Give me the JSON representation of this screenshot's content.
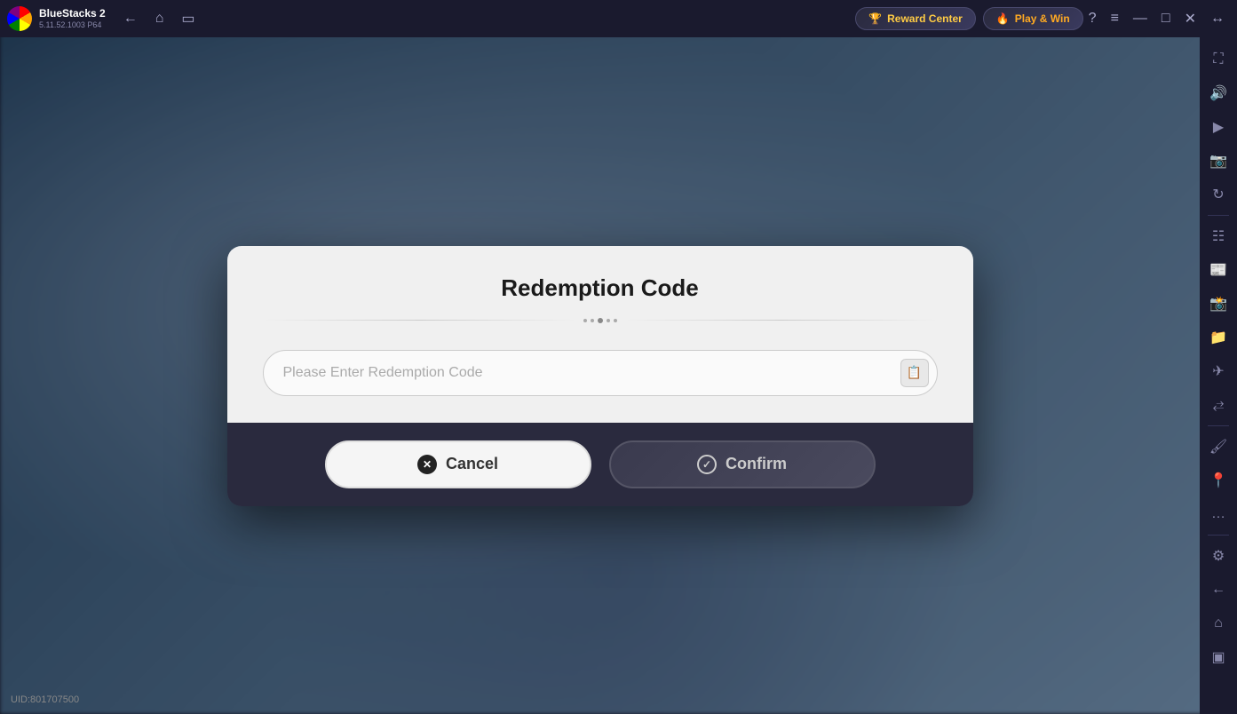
{
  "app": {
    "name": "BlueStacks 2",
    "version": "5.11.52.1003  P64"
  },
  "topbar": {
    "nav_back_label": "←",
    "nav_home_label": "⌂",
    "nav_tabs_label": "⧉",
    "reward_center_label": "Reward Center",
    "play_win_label": "Play & Win",
    "help_icon": "?",
    "menu_icon": "≡",
    "minimize_icon": "—",
    "maximize_icon": "□",
    "close_icon": "✕",
    "expand_icon": "↔"
  },
  "sidebar": {
    "icons": [
      {
        "name": "fullscreen-icon",
        "glyph": "⛶"
      },
      {
        "name": "volume-icon",
        "glyph": "🔊"
      },
      {
        "name": "video-icon",
        "glyph": "▶"
      },
      {
        "name": "camera-icon",
        "glyph": "📷"
      },
      {
        "name": "rotate-icon",
        "glyph": "↻"
      },
      {
        "name": "layers-icon",
        "glyph": "⊞"
      },
      {
        "name": "news-icon",
        "glyph": "📰"
      },
      {
        "name": "screenshot-icon",
        "glyph": "📸"
      },
      {
        "name": "folder-icon",
        "glyph": "📁"
      },
      {
        "name": "airplane-icon",
        "glyph": "✈"
      },
      {
        "name": "resize-icon",
        "glyph": "⤢"
      },
      {
        "name": "brush-icon",
        "glyph": "🖌"
      },
      {
        "name": "location-icon",
        "glyph": "📍"
      },
      {
        "name": "more-icon",
        "glyph": "…"
      },
      {
        "name": "settings-icon",
        "glyph": "⚙"
      },
      {
        "name": "back-icon",
        "glyph": "←"
      },
      {
        "name": "home-icon",
        "glyph": "⌂"
      },
      {
        "name": "recents-icon",
        "glyph": "⊟"
      }
    ]
  },
  "uid": {
    "label": "UID:801707500"
  },
  "modal": {
    "title": "Redemption Code",
    "input_placeholder": "Please Enter Redemption Code",
    "cancel_label": "Cancel",
    "confirm_label": "Confirm"
  }
}
